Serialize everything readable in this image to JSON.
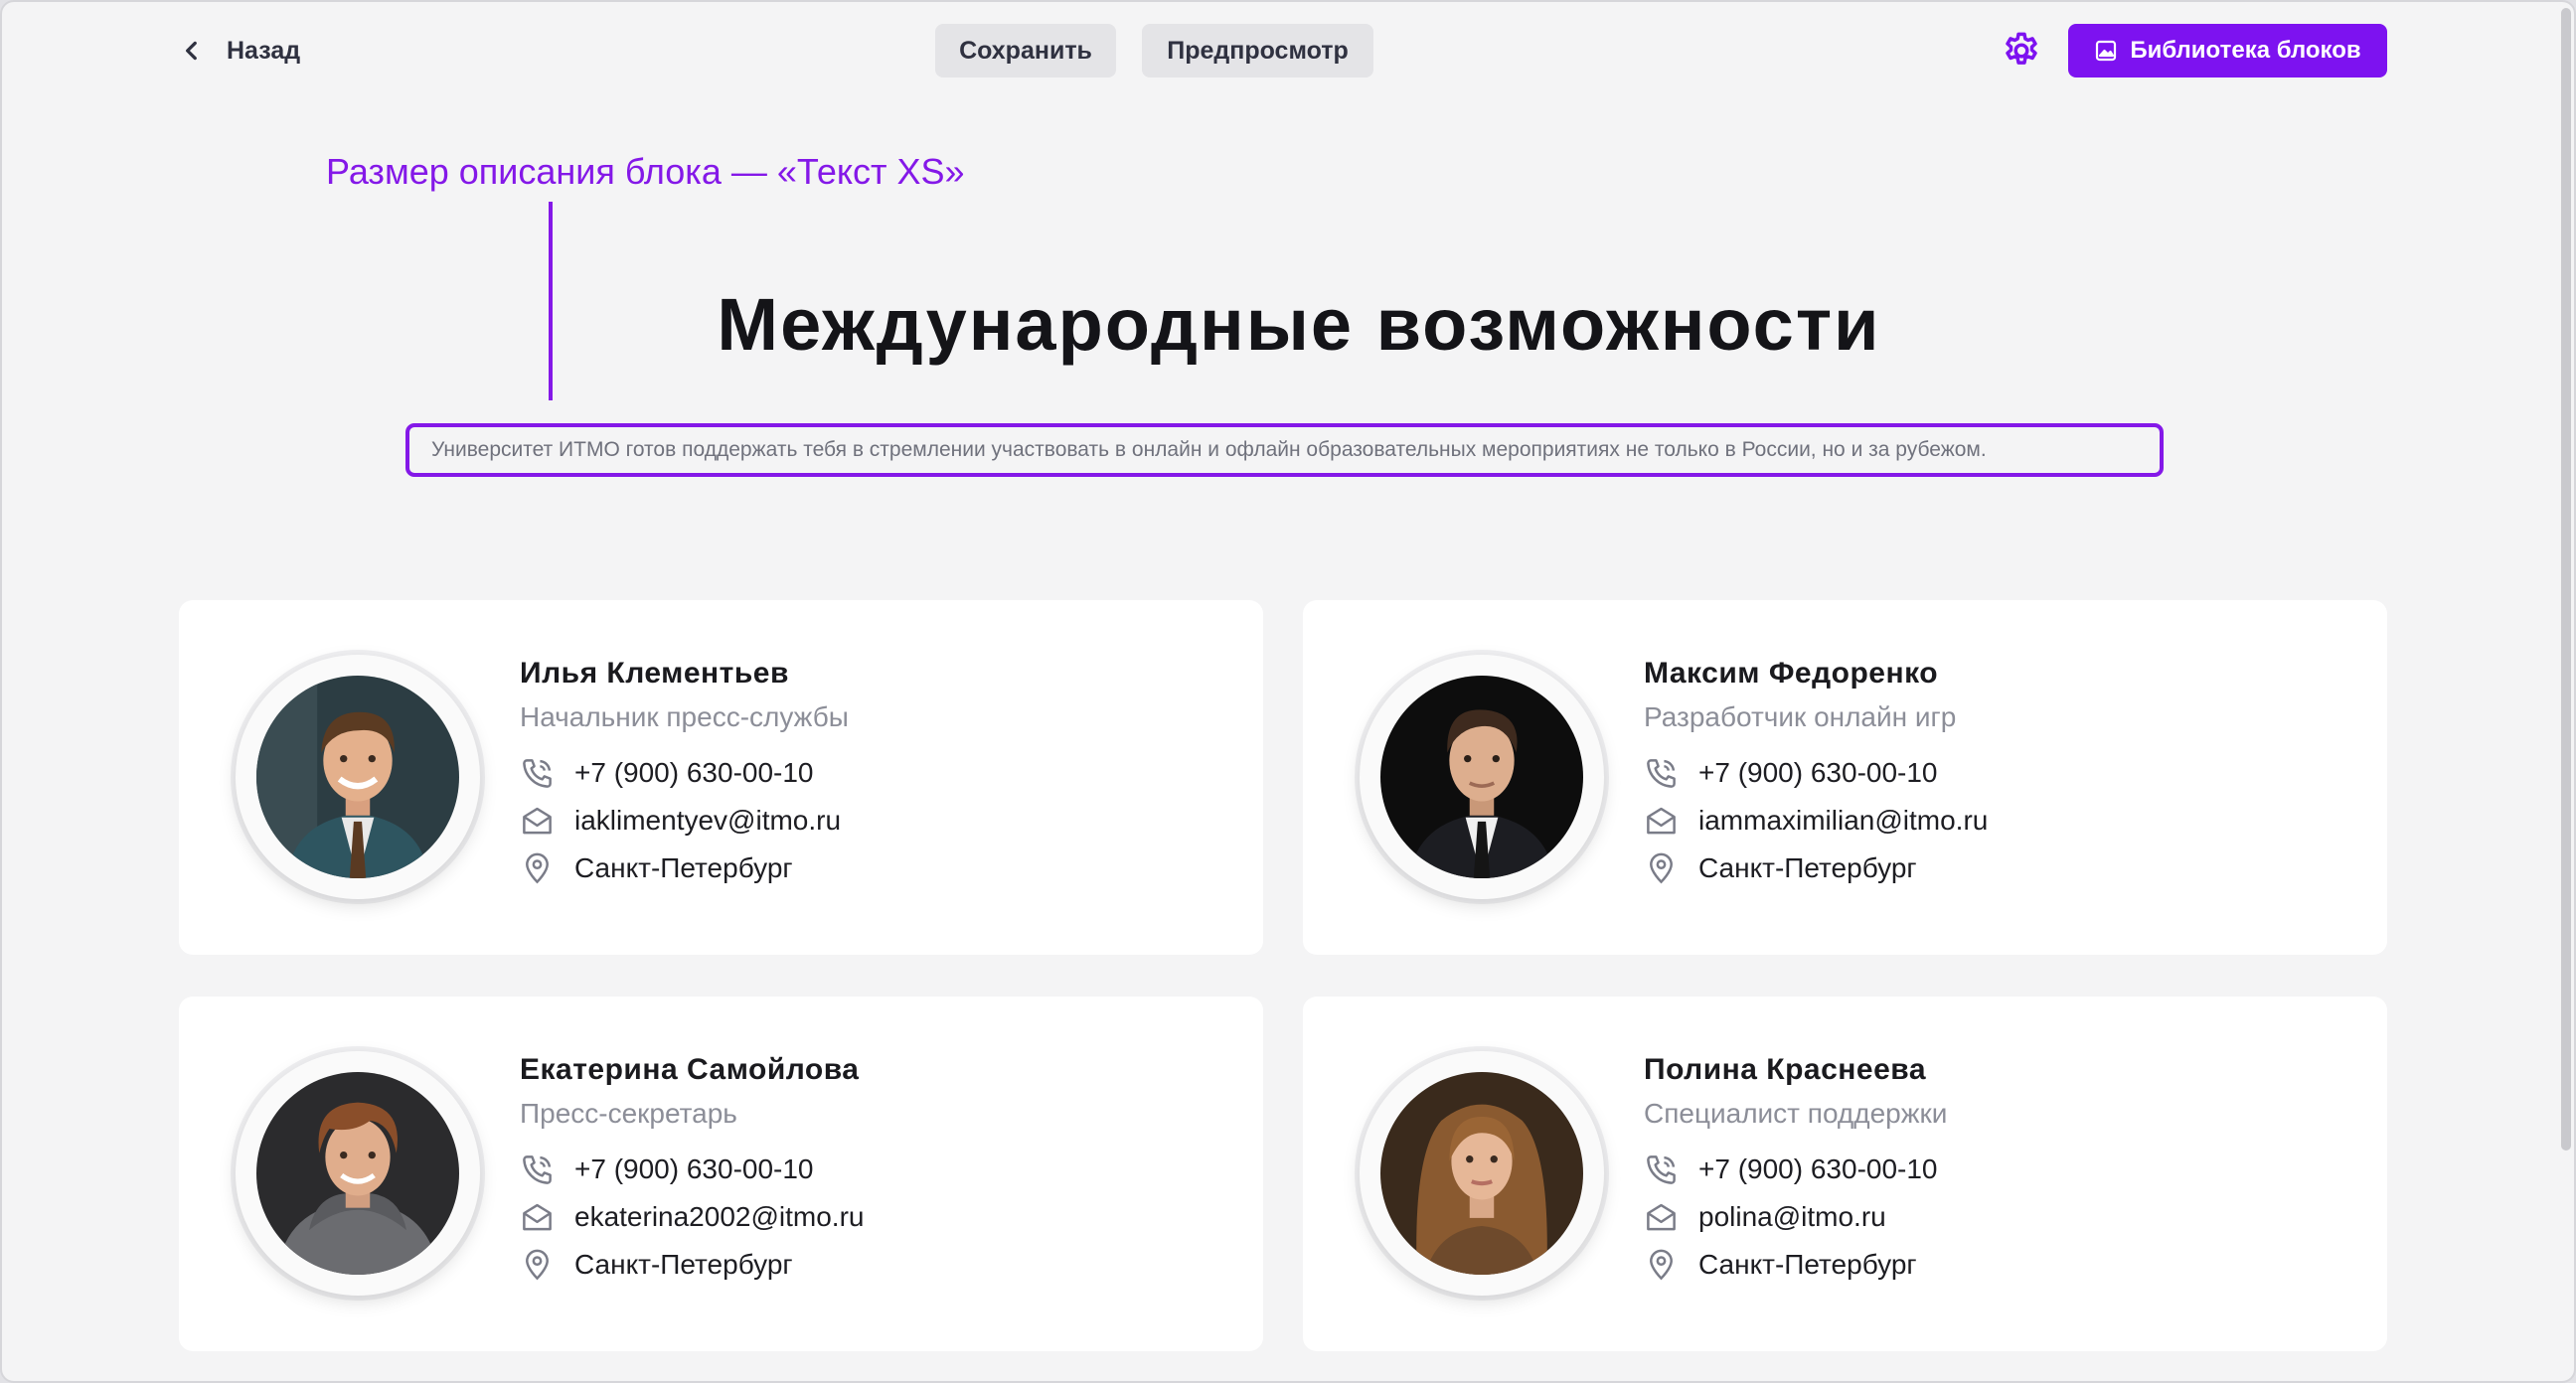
{
  "toolbar": {
    "back_label": "Назад",
    "save_label": "Сохранить",
    "preview_label": "Предпросмотр",
    "library_label": "Библиотека блоков"
  },
  "annotation": {
    "text": "Размер описания блока — «Текст XS»"
  },
  "block": {
    "title": "Международные возможности",
    "description": "Университет ИТМО готов поддержать тебя в стремлении участвовать в онлайн и офлайн образовательных мероприятиях не только в России, но и за рубежом."
  },
  "cards": [
    {
      "name": "Илья Клементьев",
      "role": "Начальник пресс-службы",
      "phone": "+7 (900) 630-00-10",
      "email": "iaklimentyev@itmo.ru",
      "city": "Санкт-Петербург"
    },
    {
      "name": "Максим Федоренко",
      "role": "Разработчик онлайн игр",
      "phone": "+7 (900) 630-00-10",
      "email": "iammaximilian@itmo.ru",
      "city": "Санкт-Петербург"
    },
    {
      "name": "Екатерина Самойлова",
      "role": "Пресс-секретарь",
      "phone": "+7 (900) 630-00-10",
      "email": "ekaterina2002@itmo.ru",
      "city": "Санкт-Петербург"
    },
    {
      "name": "Полина Краснеева",
      "role": "Специалист поддержки",
      "phone": "+7 (900) 630-00-10",
      "email": "polina@itmo.ru",
      "city": "Санкт-Петербург"
    }
  ],
  "icons": {
    "back": "chevron-left-icon",
    "settings": "gear-icon",
    "library": "image-icon",
    "phone": "phone-icon",
    "email": "envelope-icon",
    "location": "location-pin-icon"
  },
  "colors": {
    "accent": "#7d12f0",
    "annotation": "#8418e8",
    "background": "#f4f4f5",
    "card": "#ffffff"
  }
}
